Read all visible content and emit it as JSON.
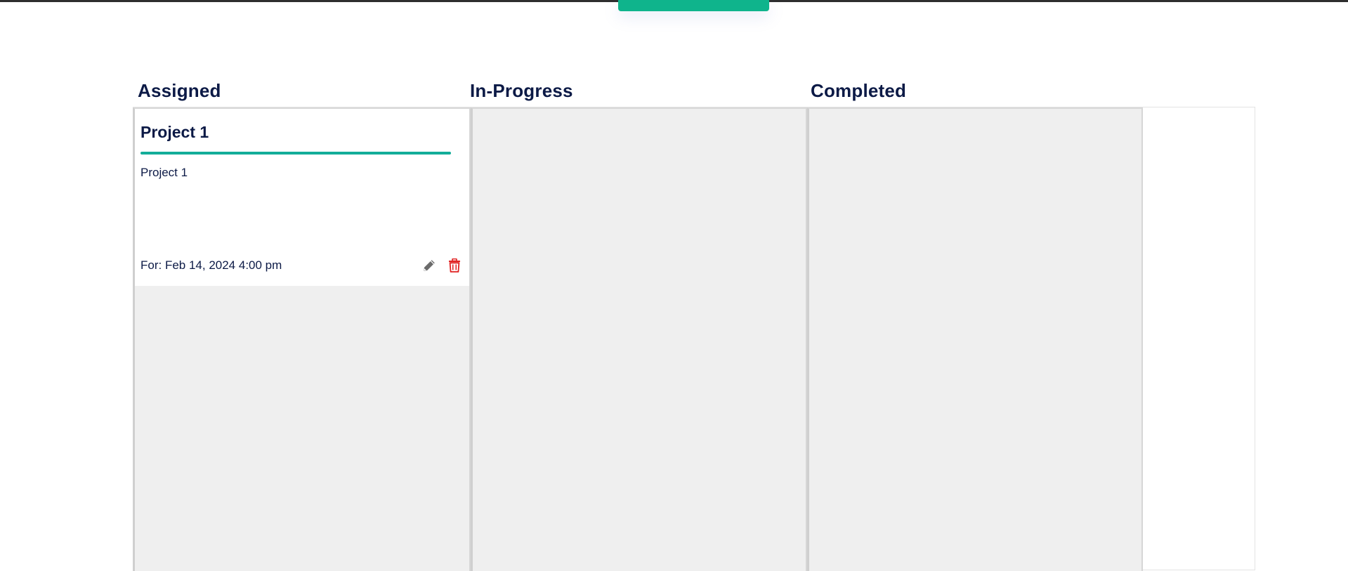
{
  "header": {
    "top_button_label": ""
  },
  "board": {
    "columns": [
      {
        "heading": "Assigned",
        "cards": [
          {
            "title": "Project 1",
            "description": "Project 1",
            "due": "For: Feb 14, 2024 4:00 pm",
            "edit_icon": "pencil-icon",
            "delete_icon": "trash-icon"
          }
        ]
      },
      {
        "heading": "In-Progress",
        "cards": []
      },
      {
        "heading": "Completed",
        "cards": []
      }
    ]
  },
  "colors": {
    "accent": "#0fb48c",
    "card_bar": "#13ad99",
    "heading_text": "#0c1a46",
    "column_bg": "#efefef",
    "delete_icon": "#e02020",
    "edit_icon": "#6b6b6b"
  }
}
